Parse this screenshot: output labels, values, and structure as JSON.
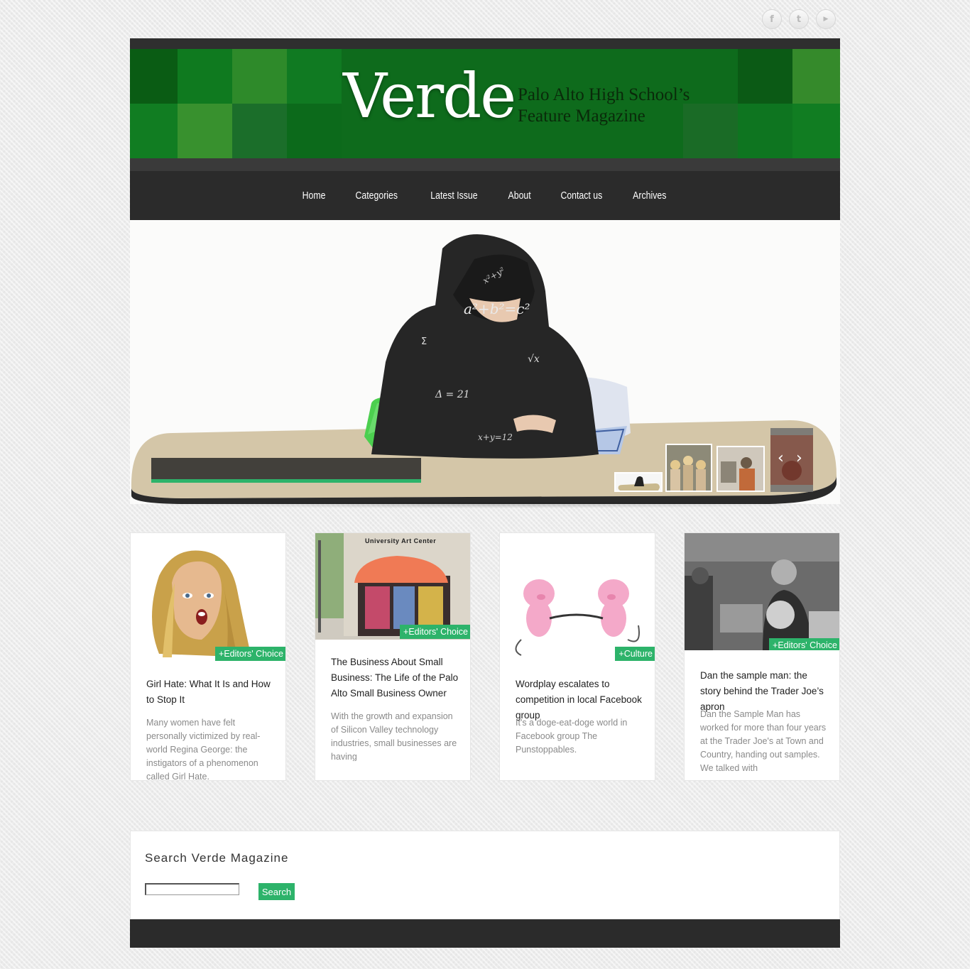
{
  "social": [
    {
      "name": "facebook-icon",
      "glyph": "f"
    },
    {
      "name": "twitter-icon",
      "glyph": "t"
    },
    {
      "name": "youtube-icon",
      "glyph": "▶"
    }
  ],
  "header": {
    "logo": "Verde",
    "tagline_line1": "Palo Alto High School’s",
    "tagline_line2": "Feature Magazine"
  },
  "nav": [
    "Home",
    "Categories",
    "Latest Issue",
    "About",
    "Contact us",
    "Archives"
  ],
  "cards": [
    {
      "badge": "+Editors' Choice",
      "title": "Girl Hate: What It Is and How to Stop It",
      "excerpt": "Many women have felt personally victimized by real-world Regina George: the instigators of a phenomenon called Girl Hate."
    },
    {
      "badge": "+Editors' Choice",
      "title": "The Business About Small Business: The Life of the Palo Alto Small Business Owner",
      "excerpt": "With the growth and expansion of Silicon Valley technology industries, small businesses are having",
      "sign": "University Art Center"
    },
    {
      "badge": "+Culture",
      "title": "Wordplay escalates to competition in local Facebook group",
      "excerpt": "It's a doge-eat-doge world in Facebook group The Punstoppables."
    },
    {
      "badge": "+Editors' Choice",
      "title": "Dan the sample man: the story behind the Trader Joe’s apron",
      "excerpt": "Dan the Sample Man has worked for more than four years at the Trader Joe's at Town and Country, handing out samples. We talked with"
    }
  ],
  "search": {
    "title": "Search Verde Magazine",
    "button": "Search",
    "value": ""
  },
  "colors": {
    "accent": "#2db36a",
    "banner_green": "#0e6b1c",
    "nav_bg": "#2b2b2b"
  }
}
